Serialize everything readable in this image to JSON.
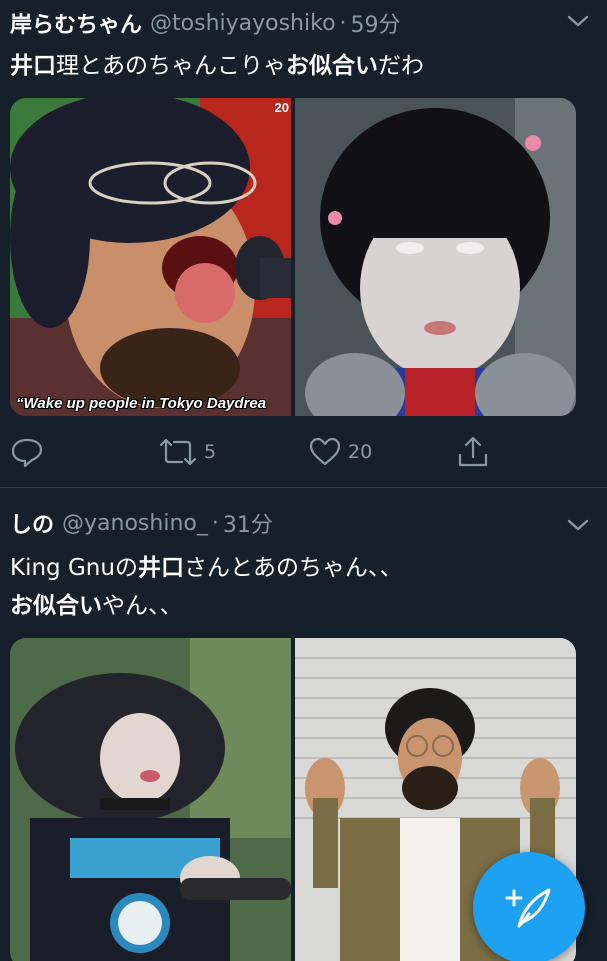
{
  "colors": {
    "background": "#15202b",
    "divider": "#38444d",
    "secondary_text": "#8899a6",
    "accent": "#1da1f2"
  },
  "tweets": [
    {
      "display_name": "岸らむちゃん",
      "handle": "@toshiyayoshiko",
      "separator": "·",
      "time": "59分",
      "text_lines": [
        [
          {
            "t": "井口",
            "bold": true
          },
          {
            "t": "理とあのちゃんこりゃ",
            "bold": false
          },
          {
            "t": "お似合い",
            "bold": true
          },
          {
            "t": "だわ",
            "bold": false
          }
        ]
      ],
      "photos": [
        {
          "caption": "“Wake up people in Tokyo Daydrea",
          "corner": "20"
        },
        {
          "caption": ""
        }
      ],
      "actions": {
        "reply": "",
        "retweet": "5",
        "like": "20"
      }
    },
    {
      "display_name": "しの",
      "handle": "@yanoshino_",
      "separator": "·",
      "time": "31分",
      "text_lines": [
        [
          {
            "t": "King Gnuの",
            "bold": false
          },
          {
            "t": "井口",
            "bold": true
          },
          {
            "t": "さんとあのちゃん、、",
            "bold": false
          }
        ],
        [
          {
            "t": "お似合い",
            "bold": true
          },
          {
            "t": "やん、、",
            "bold": false
          }
        ]
      ]
    }
  ],
  "icons": {
    "caret": "chevron-down-icon",
    "reply": "reply-icon",
    "retweet": "retweet-icon",
    "like": "heart-icon",
    "share": "share-icon",
    "compose": "compose-tweet-icon"
  }
}
